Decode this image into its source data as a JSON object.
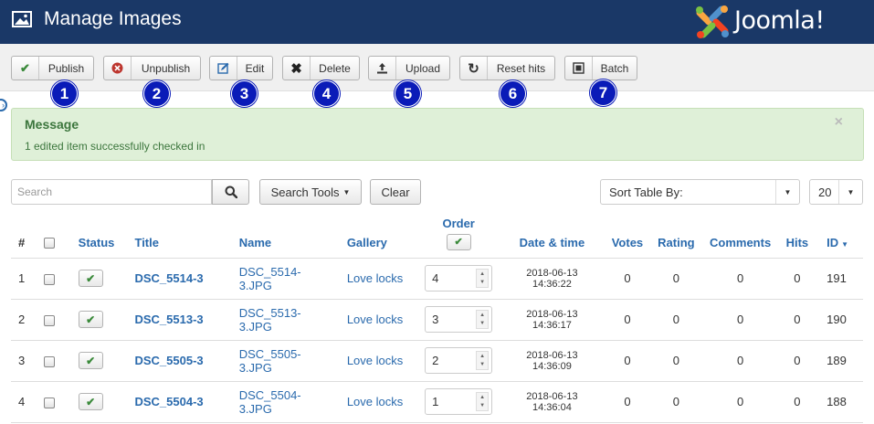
{
  "header": {
    "title": "Manage Images",
    "logo_text": "Joomla!",
    "title_icon": "image-icon"
  },
  "toolbar": [
    {
      "label": "Publish",
      "icon": "check-icon",
      "color": "#3b8a3b",
      "badge": "1"
    },
    {
      "label": "Unpublish",
      "icon": "x-circle-icon",
      "color": "#bd362f",
      "badge": "2"
    },
    {
      "label": "Edit",
      "icon": "edit-icon",
      "color": "#2a6aad",
      "badge": "3"
    },
    {
      "label": "Delete",
      "icon": "delete-icon",
      "color": "#222",
      "badge": "4"
    },
    {
      "label": "Upload",
      "icon": "upload-icon",
      "color": "#333",
      "badge": "5"
    },
    {
      "label": "Reset hits",
      "icon": "refresh-icon",
      "color": "#333",
      "badge": "6"
    },
    {
      "label": "Batch",
      "icon": "batch-icon",
      "color": "#333",
      "badge": "7"
    }
  ],
  "message": {
    "heading": "Message",
    "text": "1 edited item successfully checked in",
    "close": "×"
  },
  "filters": {
    "search_placeholder": "Search",
    "search_tools_label": "Search Tools",
    "clear_label": "Clear",
    "sort_label": "Sort Table By:",
    "limit_value": "20"
  },
  "table": {
    "headers": {
      "num": "#",
      "status": "Status",
      "title": "Title",
      "name": "Name",
      "gallery": "Gallery",
      "order": "Order",
      "date": "Date & time",
      "votes": "Votes",
      "rating": "Rating",
      "comments": "Comments",
      "hits": "Hits",
      "id": "ID"
    },
    "rows": [
      {
        "num": "1",
        "title": "DSC_5514-3",
        "name": "DSC_5514-3.JPG",
        "gallery": "Love locks",
        "order": "4",
        "date": "2018-06-13 14:36:22",
        "votes": "0",
        "rating": "0",
        "comments": "0",
        "hits": "0",
        "id": "191"
      },
      {
        "num": "2",
        "title": "DSC_5513-3",
        "name": "DSC_5513-3.JPG",
        "gallery": "Love locks",
        "order": "3",
        "date": "2018-06-13 14:36:17",
        "votes": "0",
        "rating": "0",
        "comments": "0",
        "hits": "0",
        "id": "190"
      },
      {
        "num": "3",
        "title": "DSC_5505-3",
        "name": "DSC_5505-3.JPG",
        "gallery": "Love locks",
        "order": "2",
        "date": "2018-06-13 14:36:09",
        "votes": "0",
        "rating": "0",
        "comments": "0",
        "hits": "0",
        "id": "189"
      },
      {
        "num": "4",
        "title": "DSC_5504-3",
        "name": "DSC_5504-3.JPG",
        "gallery": "Love locks",
        "order": "1",
        "date": "2018-06-13 14:36:04",
        "votes": "0",
        "rating": "0",
        "comments": "0",
        "hits": "0",
        "id": "188"
      }
    ]
  }
}
